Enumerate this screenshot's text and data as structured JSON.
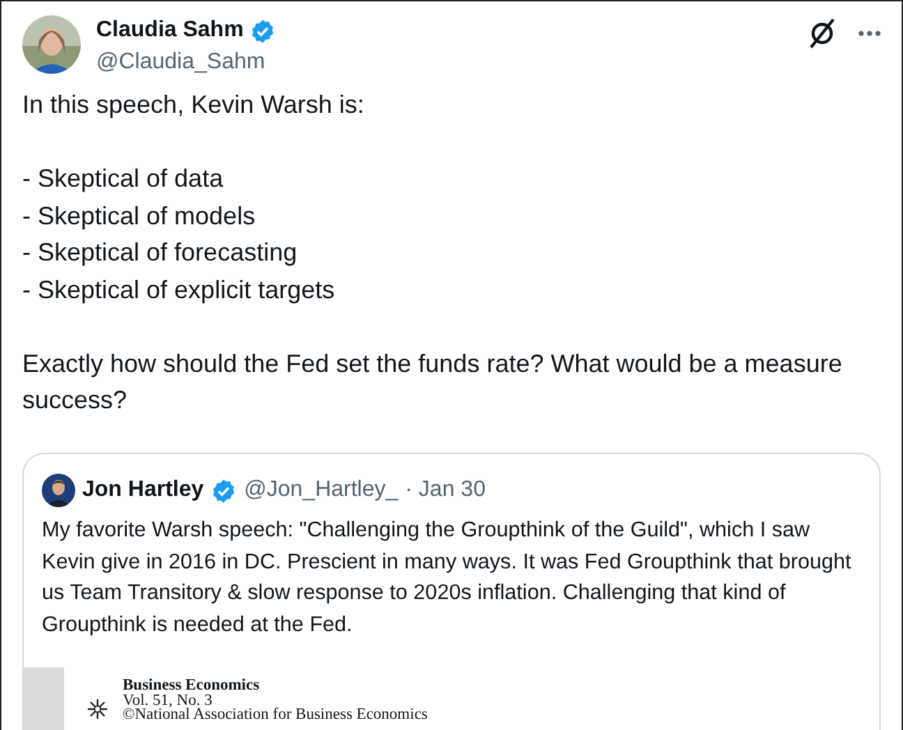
{
  "author": {
    "name": "Claudia Sahm",
    "handle": "@Claudia_Sahm",
    "verified": true
  },
  "body": {
    "intro": "In this speech, Kevin Warsh is:",
    "bullets": [
      "- Skeptical of data",
      "- Skeptical of models",
      "- Skeptical of forecasting",
      "- Skeptical of explicit targets"
    ],
    "question": "Exactly how should the Fed set the funds rate? What would be a measure success?"
  },
  "quote": {
    "name": "Jon Hartley",
    "verified": true,
    "handle": "@Jon_Hartley_",
    "date": "· Jan 30",
    "text": "My favorite Warsh speech: \"Challenging the Groupthink of the Guild\", which I saw Kevin give in 2016 in DC. Prescient in many ways. It was Fed Groupthink that brought us Team Transitory & slow response to 2020s inflation. Challenging that kind of Groupthink is needed at the Fed.",
    "document": {
      "journal": "Business Economics",
      "volume": "Vol. 51, No. 3",
      "copyright": "©National Association for Business Economics"
    }
  }
}
